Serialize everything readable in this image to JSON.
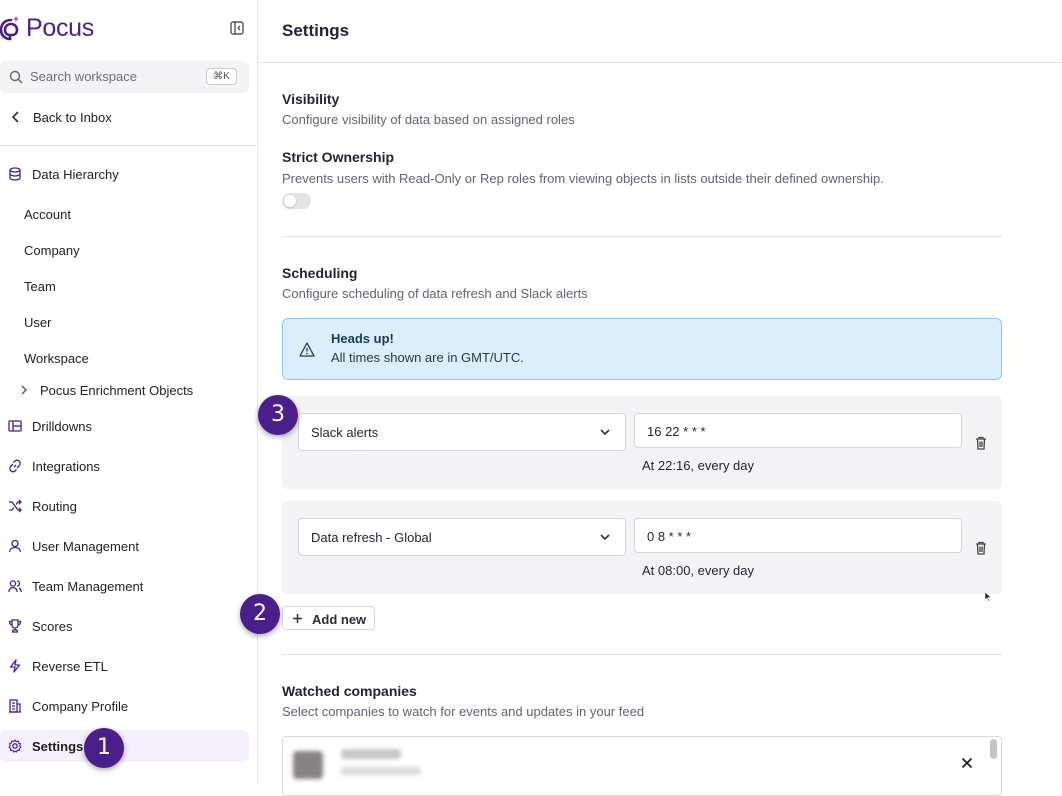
{
  "app": {
    "name": "Pocus"
  },
  "sidebar": {
    "search_placeholder": "Search workspace",
    "search_shortcut": "⌘K",
    "back_label": "Back to Inbox",
    "data_hierarchy": {
      "label": "Data Hierarchy",
      "children": [
        "Account",
        "Company",
        "Team",
        "User",
        "Workspace"
      ],
      "enrichment_label": "Pocus Enrichment Objects"
    },
    "items": [
      {
        "label": "Drilldowns",
        "icon": "drilldowns-icon"
      },
      {
        "label": "Integrations",
        "icon": "link-icon"
      },
      {
        "label": "Routing",
        "icon": "shuffle-icon"
      },
      {
        "label": "User Management",
        "icon": "user-icon"
      },
      {
        "label": "Team Management",
        "icon": "users-icon"
      },
      {
        "label": "Scores",
        "icon": "trophy-icon"
      },
      {
        "label": "Reverse ETL",
        "icon": "bolt-icon"
      },
      {
        "label": "Company Profile",
        "icon": "building-icon"
      },
      {
        "label": "Settings",
        "icon": "gear-icon",
        "active": true
      }
    ]
  },
  "header": {
    "title": "Settings"
  },
  "visibility": {
    "title": "Visibility",
    "description": "Configure visibility of data based on assigned roles",
    "strict_title": "Strict Ownership",
    "strict_description": "Prevents users with Read-Only or Rep roles from viewing objects in lists outside their defined ownership.",
    "strict_enabled": false
  },
  "scheduling": {
    "title": "Scheduling",
    "description": "Configure scheduling of data refresh and Slack alerts",
    "alert_title": "Heads up!",
    "alert_body": "All times shown are in GMT/UTC.",
    "rows": [
      {
        "type": "Slack alerts",
        "cron": "16 22 * * *",
        "human": "At 22:16, every day"
      },
      {
        "type": "Data refresh - Global",
        "cron": "0 8 * * *",
        "human": "At 08:00, every day"
      }
    ],
    "add_label": "Add new"
  },
  "watched": {
    "title": "Watched companies",
    "description": "Select companies to watch for events and updates in your feed"
  },
  "markers": [
    "1",
    "2",
    "3"
  ],
  "colors": {
    "brand": "#4a1f8c",
    "active_bg": "#f6f0fc",
    "alert_bg": "#dbeefb",
    "alert_border": "#8ccaf1"
  }
}
